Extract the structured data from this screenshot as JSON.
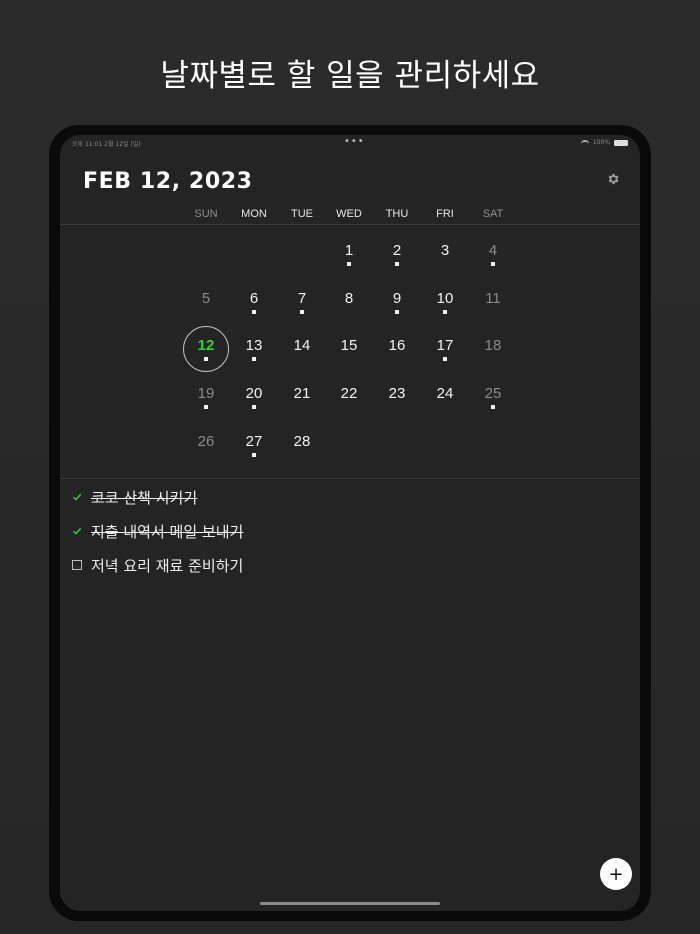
{
  "headline": "날짜별로 할 일을 관리하세요",
  "status_bar": {
    "time": "오후 11:01   2월 12일 (일)",
    "menu_dots": "•••",
    "battery": "100%"
  },
  "header": {
    "date_title": "FEB 12, 2023",
    "settings_icon": "gear-icon"
  },
  "weekdays": [
    "SUN",
    "MON",
    "TUE",
    "WED",
    "THU",
    "FRI",
    "SAT"
  ],
  "calendar": {
    "today": "12",
    "days": [
      {
        "n": "1",
        "dot": true
      },
      {
        "n": "2",
        "dot": true
      },
      {
        "n": "3",
        "dot": false
      },
      {
        "n": "4",
        "dot": true
      },
      {
        "n": "5",
        "dot": false
      },
      {
        "n": "6",
        "dot": true
      },
      {
        "n": "7",
        "dot": true
      },
      {
        "n": "8",
        "dot": false
      },
      {
        "n": "9",
        "dot": true
      },
      {
        "n": "10",
        "dot": true
      },
      {
        "n": "11",
        "dot": false
      },
      {
        "n": "12",
        "dot": true
      },
      {
        "n": "13",
        "dot": true
      },
      {
        "n": "14",
        "dot": false
      },
      {
        "n": "15",
        "dot": false
      },
      {
        "n": "16",
        "dot": false
      },
      {
        "n": "17",
        "dot": true
      },
      {
        "n": "18",
        "dot": false
      },
      {
        "n": "19",
        "dot": true
      },
      {
        "n": "20",
        "dot": true
      },
      {
        "n": "21",
        "dot": false
      },
      {
        "n": "22",
        "dot": false
      },
      {
        "n": "23",
        "dot": false
      },
      {
        "n": "24",
        "dot": false
      },
      {
        "n": "25",
        "dot": true
      },
      {
        "n": "26",
        "dot": false
      },
      {
        "n": "27",
        "dot": true
      },
      {
        "n": "28",
        "dot": false
      }
    ]
  },
  "todos": [
    {
      "label": "코코 산책 시키기",
      "done": true
    },
    {
      "label": "지출 내역서 메일 보내기",
      "done": true
    },
    {
      "label": "저녁 요리 재료 준비하기",
      "done": false
    }
  ],
  "fab_label": "+",
  "colors": {
    "accent_today": "#2cd92c",
    "check": "#2cd92c",
    "background": "#242424"
  }
}
